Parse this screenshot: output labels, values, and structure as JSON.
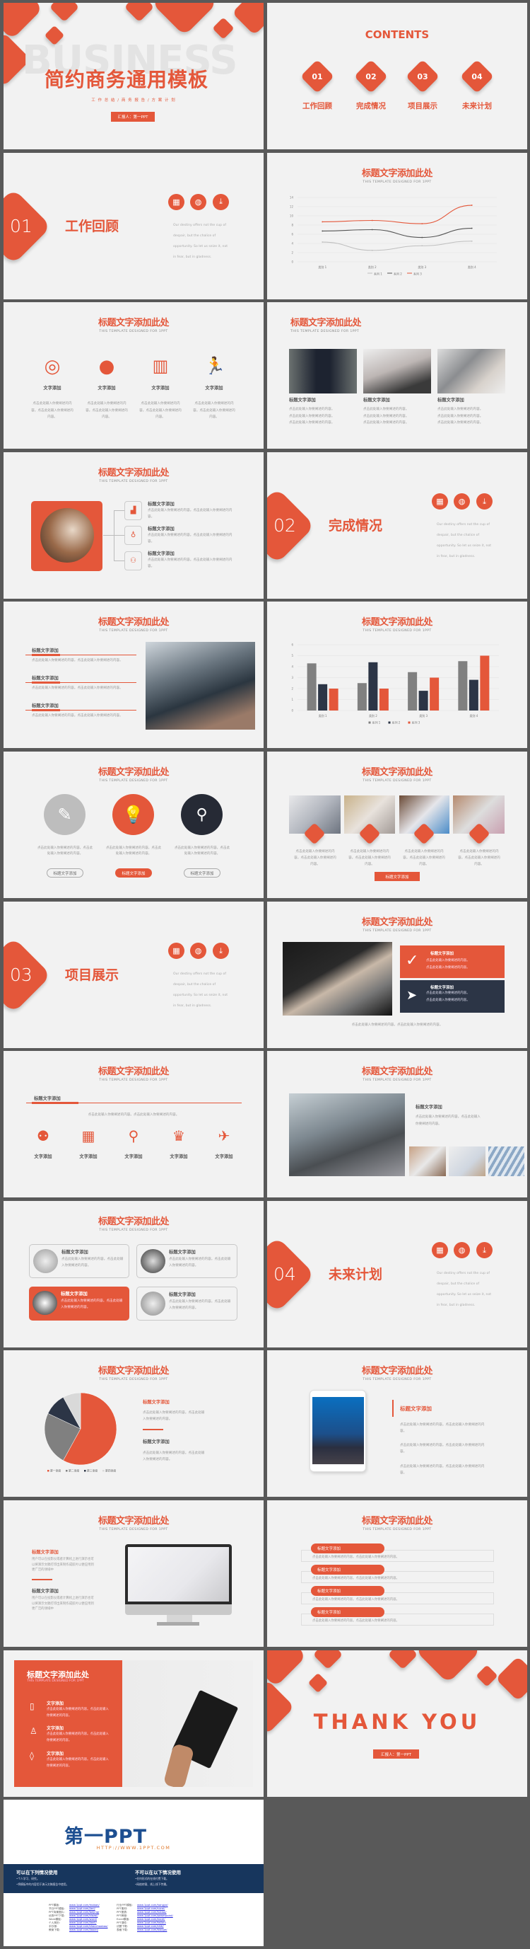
{
  "colors": {
    "accent": "#e4573a",
    "navy": "#2c3546",
    "gray": "#808080",
    "light": "#d9d9d9",
    "background": "#f2f2f2"
  },
  "common": {
    "title": "标题文字添加此处",
    "subtitle": "THIS TEMPLATE DESIGNED FOR 1PPT",
    "heading": "标题文字添加",
    "text_add": "文字添加",
    "body": "点击此处输入你要阐述的内容。点击此处输入你要阐述的内容。",
    "body_line": "点击此处输入你要阐述的内容。",
    "quote": "Our destiny offers not the cup of despair, but the chalice of opportunity. So let us seize it, not in fear, but in gladness.",
    "paragraph": "用户可以在投影仪或者计算机上进行演示也可以将演示文稿打印出来制作成胶片以便应用到更广泛的领域中"
  },
  "cover": {
    "bg_word": "BUSINESS",
    "title": "简约商务通用模板",
    "subtitle": "工 作 总 结 / 商 务 报 告 / 方 案 计 划",
    "reporter": "汇报人：第一PPT"
  },
  "contents": {
    "heading": "CONTENTS",
    "items": [
      {
        "num": "01",
        "label": "工作回顾"
      },
      {
        "num": "02",
        "label": "完成情况"
      },
      {
        "num": "03",
        "label": "项目展示"
      },
      {
        "num": "04",
        "label": "未来计划"
      }
    ]
  },
  "section_icons": [
    "calculator-icon",
    "globe-icon",
    "download-icon"
  ],
  "thanks": {
    "text": "THANK YOU",
    "reporter": "汇报人：第一PPT"
  },
  "ad": {
    "logo": "第一PPT",
    "url": "HTTP://WWW.1PPT.COM",
    "can_title": "可以在下列情况使用",
    "can": [
      "•个人学习、研究。",
      "•将模板中的内容用于演示文稿报告中使用。"
    ],
    "cannot_title": "不可以在以下情况使用",
    "cannot": [
      "•任何形式的在线付费下载。",
      "•网络转载、线上线下传播。"
    ],
    "links_left": [
      [
        "PPT模板:",
        "www.1ppt.com/moban/"
      ],
      [
        "节日PPT模板:",
        "www.1ppt.com/jieri/"
      ],
      [
        "PPT背景图片:",
        "www.1ppt.com/beijing/"
      ],
      [
        "优秀PPT下载:",
        "www.1ppt.com/xiazai/"
      ],
      [
        "Word模板:",
        "www.1ppt.com/word/"
      ],
      [
        "个人简历:",
        "www.1ppt.com/jianli/"
      ],
      [
        "手抄报:",
        "www.1ppt.com/shouchaobao/"
      ],
      [
        "教案下载:",
        "www.1ppt.com/jiaoan/"
      ]
    ],
    "links_right": [
      [
        "行业PPT模板:",
        "www.1ppt.com/hangye/"
      ],
      [
        "PPT素材:",
        "www.1ppt.com/sucai/"
      ],
      [
        "PPT图表:",
        "www.1ppt.com/tubiao/"
      ],
      [
        "PPT教程:",
        "www.1ppt.com/powerpoint/"
      ],
      [
        "Excel模板:",
        "www.1ppt.com/excel/"
      ],
      [
        "PPT课件:",
        "www.1ppt.com/kejian/"
      ],
      [
        "试题下载:",
        "www.1ppt.com/shiti/"
      ],
      [
        "表格下载:",
        "www.1ppt.com/biaoge/"
      ]
    ]
  },
  "chart_data": [
    {
      "type": "line",
      "title": "标题文字添加此处",
      "categories": [
        "类别 1",
        "类别 2",
        "类别 3",
        "类别 4"
      ],
      "ylim": [
        0,
        14
      ],
      "yticks": [
        0,
        2,
        4,
        6,
        8,
        10,
        12,
        14
      ],
      "grid": true,
      "legend": "bottom",
      "series": [
        {
          "name": "系列 1",
          "color": "#bfbfbf",
          "values": [
            4.3,
            2.5,
            3.5,
            4.5
          ]
        },
        {
          "name": "系列 2",
          "color": "#555555",
          "values": [
            6.7,
            7.0,
            5.3,
            7.3
          ]
        },
        {
          "name": "系列 3",
          "color": "#e4573a",
          "values": [
            8.7,
            9.0,
            8.3,
            12.3
          ]
        }
      ]
    },
    {
      "type": "bar",
      "title": "标题文字添加此处",
      "categories": [
        "类别 1",
        "类别 2",
        "类别 3",
        "类别 4"
      ],
      "ylim": [
        0,
        6
      ],
      "yticks": [
        0,
        1,
        2,
        3,
        4,
        5,
        6
      ],
      "grid": true,
      "legend": "bottom",
      "series": [
        {
          "name": "系列 1",
          "color": "#808080",
          "values": [
            4.3,
            2.5,
            3.5,
            4.5
          ]
        },
        {
          "name": "系列 2",
          "color": "#2c3546",
          "values": [
            2.4,
            4.4,
            1.8,
            2.8
          ]
        },
        {
          "name": "系列 3",
          "color": "#e4573a",
          "values": [
            2.0,
            2.0,
            3.0,
            5.0
          ]
        }
      ]
    },
    {
      "type": "pie",
      "title": "标题文字添加此处",
      "legend": "bottom",
      "categories": [
        "第一季度",
        "第二季度",
        "第三季度",
        "第四季度"
      ],
      "values": [
        58,
        24,
        10,
        8
      ],
      "colors": [
        "#e4573a",
        "#808080",
        "#2c3546",
        "#d9d9d9"
      ]
    }
  ]
}
